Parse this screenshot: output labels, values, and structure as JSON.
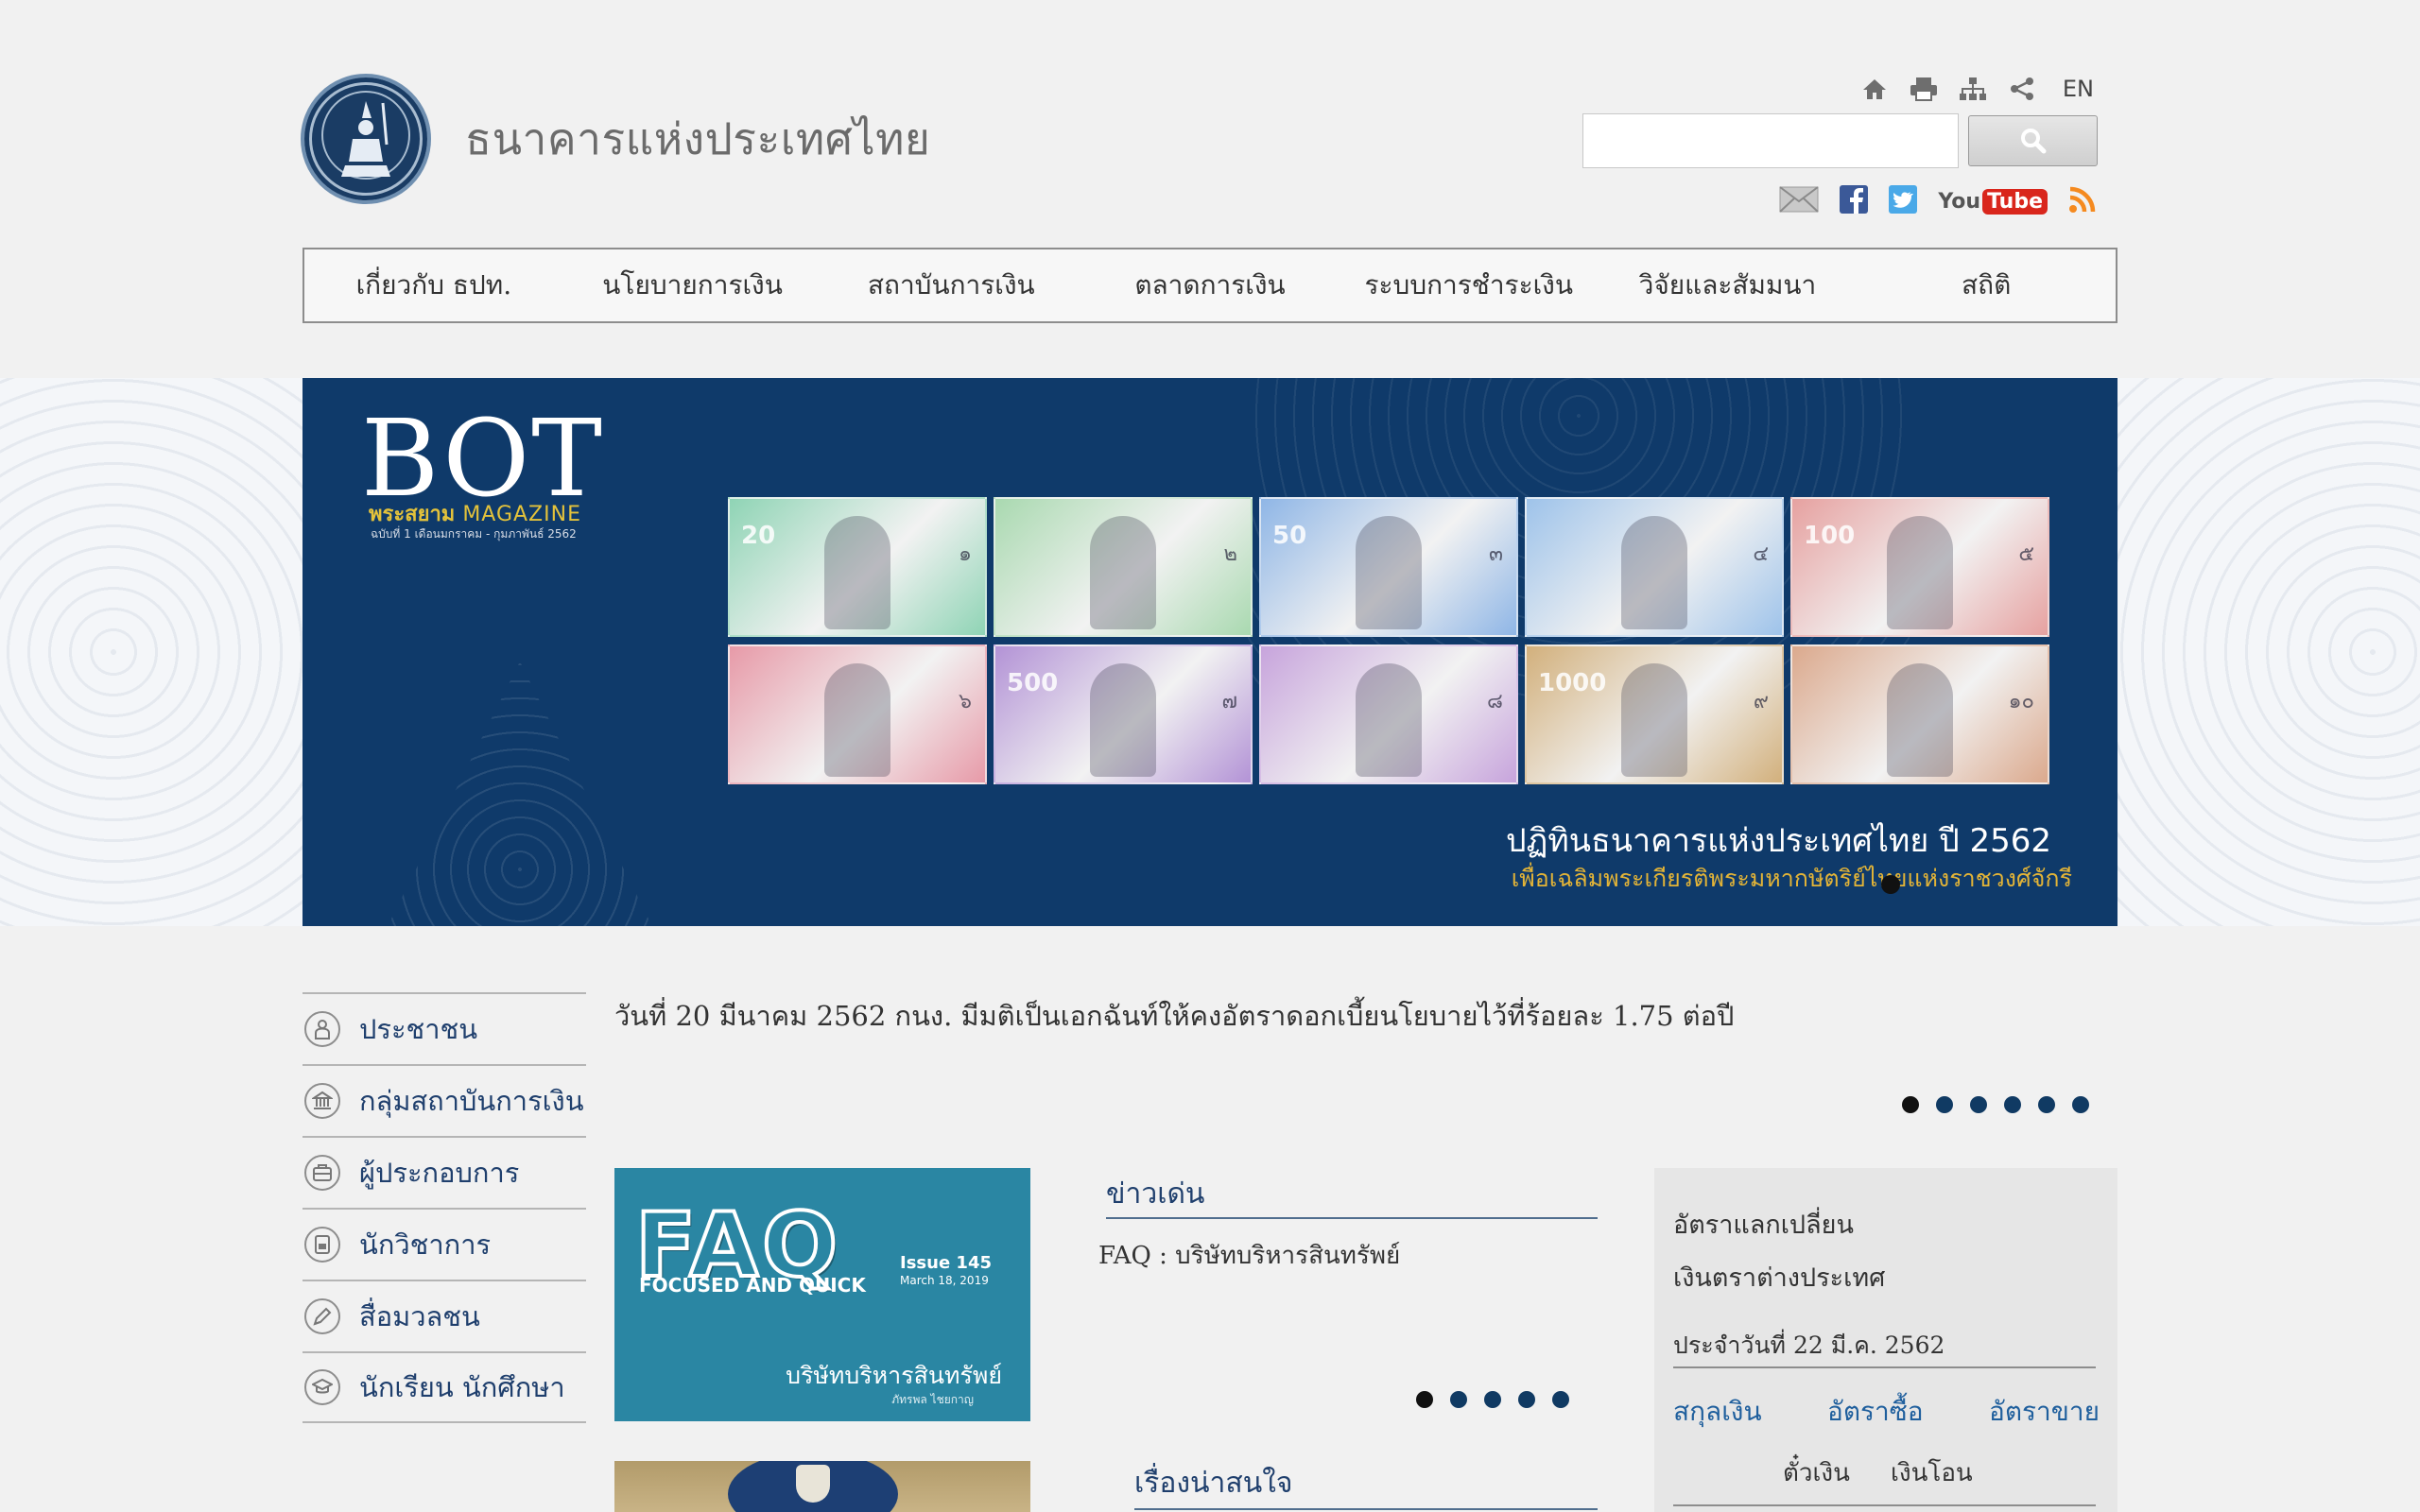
{
  "header": {
    "site_name": "ธนาคารแห่งประเทศไทย",
    "lang_toggle": "EN",
    "search_placeholder": "",
    "youtube_you": "You",
    "youtube_tube": "Tube"
  },
  "nav": {
    "items": [
      "เกี่ยวกับ ธปท.",
      "นโยบายการเงิน",
      "สถาบันการเงิน",
      "ตลาดการเงิน",
      "ระบบการชำระเงิน",
      "วิจัยและสัมมนา",
      "สถิติ"
    ]
  },
  "banner": {
    "title": "BOT",
    "magazine_th": "พระสยาม",
    "magazine_en": "MAGAZINE",
    "issue_line": "ฉบับที่ 1 เดือนมกราคม - กุมภาพันธ์ 2562",
    "caption_main": "ปฏิทินธนาคารแห่งประเทศไทย ปี 2562",
    "caption_sub": "เพื่อเฉลิมพระเกียรติพระมหากษัตริย์ไทยแห่งราชวงศ์จักรี",
    "notes": [
      {
        "denom": "20",
        "num": "๑",
        "color": "#8fd4b5"
      },
      {
        "denom": "",
        "num": "๒",
        "color": "#a9d9b0"
      },
      {
        "denom": "50",
        "num": "๓",
        "color": "#8fb6e6"
      },
      {
        "denom": "",
        "num": "๔",
        "color": "#9ec3ea"
      },
      {
        "denom": "100",
        "num": "๕",
        "color": "#e6a1a0"
      },
      {
        "denom": "",
        "num": "๖",
        "color": "#e79aa8"
      },
      {
        "denom": "500",
        "num": "๗",
        "color": "#b393d6"
      },
      {
        "denom": "",
        "num": "๘",
        "color": "#c7a4dc"
      },
      {
        "denom": "1000",
        "num": "๙",
        "color": "#d2b07c"
      },
      {
        "denom": "",
        "num": "๑๐",
        "color": "#dba98d"
      }
    ]
  },
  "sidebar": {
    "items": [
      {
        "label": "ประชาชน",
        "icon": "person-icon"
      },
      {
        "label": "กลุ่มสถาบันการเงิน",
        "icon": "bank-icon"
      },
      {
        "label": "ผู้ประกอบการ",
        "icon": "briefcase-icon"
      },
      {
        "label": "นักวิชาการ",
        "icon": "book-icon"
      },
      {
        "label": "สื่อมวลชน",
        "icon": "pen-icon"
      },
      {
        "label": "นักเรียน นักศึกษา",
        "icon": "graduation-cap-icon"
      }
    ]
  },
  "headline": {
    "text": "วันที่ 20 มีนาคม 2562 กนง. มีมติเป็นเอกฉันท์ให้คงอัตราดอกเบี้ยนโยบายไว้ที่ร้อยละ 1.75 ต่อปี"
  },
  "faq_card": {
    "big": "FAQ",
    "sub": "FOCUSED AND QUICK",
    "issue": "Issue 145",
    "date": "March 18, 2019",
    "title_th": "บริษัทบริหารสินทรัพย์",
    "author": "ภัทรพล ไชยกาญ"
  },
  "news": {
    "title": "ข่าวเด่น",
    "item": "FAQ : บริษัทบริหารสินทรัพย์"
  },
  "interest": {
    "title": "เรื่องน่าสนใจ"
  },
  "fx": {
    "title1": "อัตราแลกเปลี่ยน",
    "title2": "เงินตราต่างประเทศ",
    "date": "ประจำวันที่ 22 มี.ค. 2562",
    "col_currency": "สกุลเงิน",
    "col_buy": "อัตราซื้อ",
    "col_sell": "อัตราขาย",
    "sub_draft": "ตั๋วเงิน",
    "sub_transfer": "เงินโอน"
  },
  "colors": {
    "navy": "#0f3a6a",
    "link": "#1f3f6d",
    "gold": "#e3c23b",
    "faq_teal": "#2a86a3"
  }
}
